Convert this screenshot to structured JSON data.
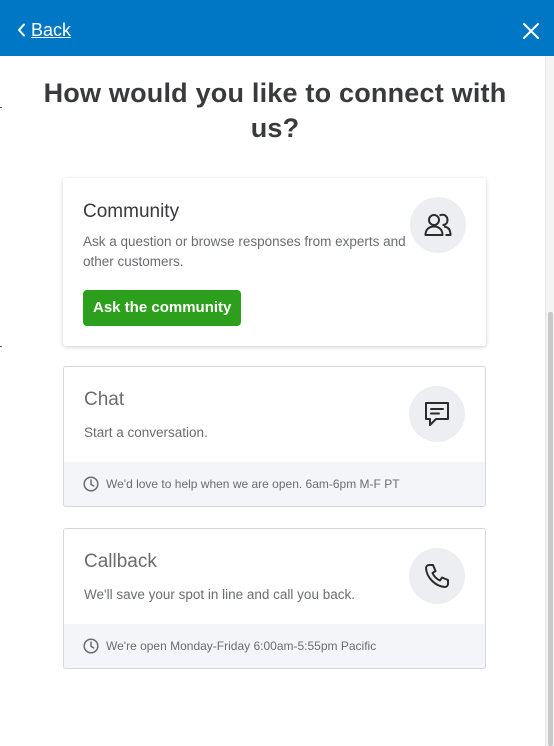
{
  "header": {
    "back_label": "Back",
    "accent_color": "#0077c5"
  },
  "page": {
    "title": "How would you like to connect with us?"
  },
  "cards": {
    "community": {
      "title": "Community",
      "description": "Ask a question or browse responses from experts and other customers.",
      "button_label": "Ask the community",
      "button_color": "#2ca01c",
      "icon": "people-icon"
    },
    "chat": {
      "title": "Chat",
      "description": "Start a conversation.",
      "hours": "We'd love to help when we are open. 6am-6pm M-F PT",
      "icon": "chat-bubble-icon"
    },
    "callback": {
      "title": "Callback",
      "description": "We'll save your spot in line and call you back.",
      "hours": "We're open Monday-Friday 6:00am-5:55pm Pacific",
      "icon": "phone-icon"
    }
  }
}
